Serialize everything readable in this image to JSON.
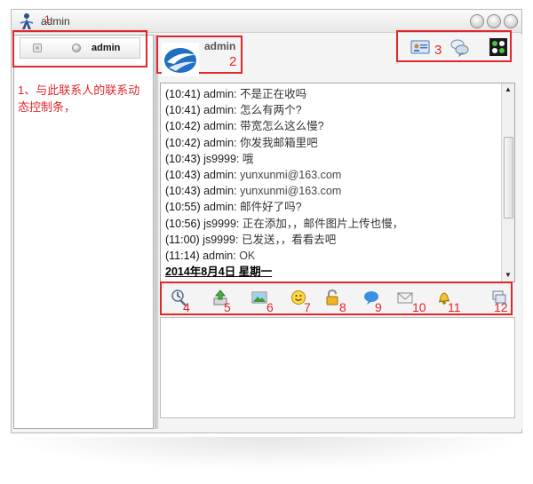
{
  "window": {
    "title": "admin"
  },
  "contact_bar": {
    "annotation_number": "1",
    "contact_name": "admin",
    "note": "1、与此联系人的联系动态控制条，"
  },
  "chat_header": {
    "avatar_name": "admin",
    "annotation_number": "2",
    "tools_annotation_number": "3",
    "tools": [
      "contact-card-icon",
      "chat-bubbles-icon",
      "dots-app-icon"
    ]
  },
  "messages": [
    {
      "time": "(10:41)",
      "sender": "admin:",
      "text": "不是正在收吗"
    },
    {
      "time": "(10:41)",
      "sender": "admin:",
      "text": "怎么有两个?"
    },
    {
      "time": "(10:42)",
      "sender": "admin:",
      "text": "带宽怎么这么慢?"
    },
    {
      "time": "(10:42)",
      "sender": "admin:",
      "text": "你发我邮箱里吧"
    },
    {
      "time": "(10:43)",
      "sender": "js9999:",
      "text": "哦"
    },
    {
      "time": "(10:43)",
      "sender": "admin:",
      "text": "yunxunmi@163.com"
    },
    {
      "time": "(10:43)",
      "sender": "admin:",
      "text": "yunxunmi@163.com"
    },
    {
      "time": "(10:55)",
      "sender": "admin:",
      "text": "邮件好了吗?"
    },
    {
      "time": "(10:56)",
      "sender": "js9999:",
      "text": "正在添加，，邮件图片上传也慢，"
    },
    {
      "time": "(11:00)",
      "sender": "js9999:",
      "text": "已发送，，看看去吧"
    },
    {
      "time": "(11:14)",
      "sender": "admin:",
      "text": "OK"
    }
  ],
  "date_separator": "2014年8月4日 星期一",
  "toolbar": [
    {
      "icon": "screenshot-tool-icon",
      "number": "4"
    },
    {
      "icon": "file-transfer-icon",
      "number": "5"
    },
    {
      "icon": "image-icon",
      "number": "6"
    },
    {
      "icon": "emoji-icon",
      "number": "7"
    },
    {
      "icon": "lock-icon",
      "number": "8"
    },
    {
      "icon": "speech-bubble-icon",
      "number": "9"
    },
    {
      "icon": "mail-icon",
      "number": "10"
    },
    {
      "icon": "bell-icon",
      "number": "11"
    },
    {
      "icon": "window-copy-icon",
      "number": "12"
    }
  ],
  "colors": {
    "annotation": "#e2262a",
    "accent": "#2a7fd4"
  }
}
